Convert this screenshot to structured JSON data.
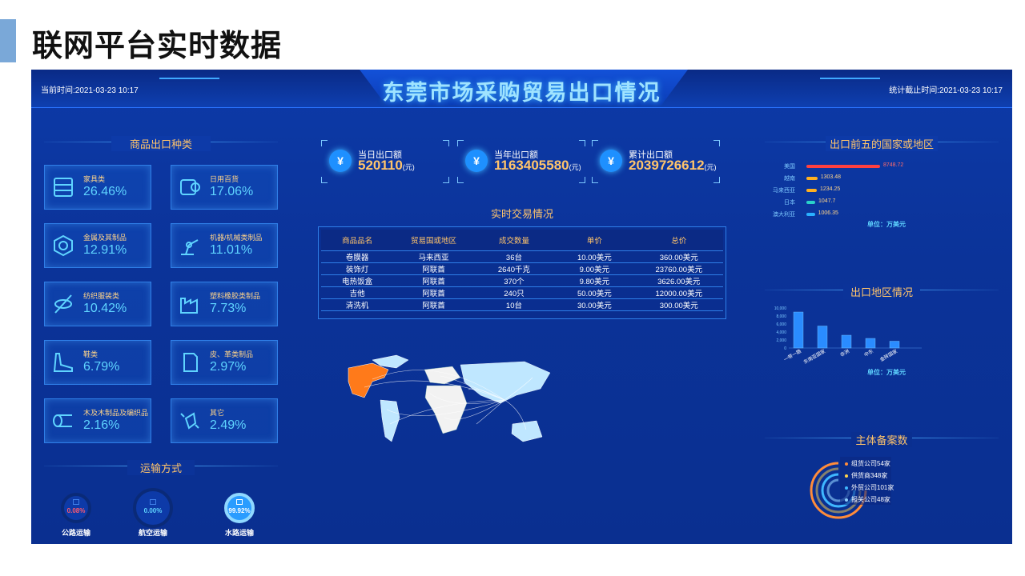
{
  "slide": {
    "title": "联网平台实时数据"
  },
  "header": {
    "main_title": "东莞市场采购贸易出口情况",
    "current_time": "当前时间:2021-03-23 10:17",
    "deadline_time": "统计截止时间:2021-03-23 10:17"
  },
  "categories": {
    "title": "商品出口种类",
    "items": [
      {
        "name": "家具类",
        "pct": "26.46%",
        "icon": "furniture-icon"
      },
      {
        "name": "日用百货",
        "pct": "17.06%",
        "icon": "tissue-roll-icon"
      },
      {
        "name": "金属及其制品",
        "pct": "12.91%",
        "icon": "hex-nut-icon"
      },
      {
        "name": "机器/机械类制品",
        "pct": "11.01%",
        "icon": "robot-arm-icon"
      },
      {
        "name": "纺织服装类",
        "pct": "10.42%",
        "icon": "thread-icon"
      },
      {
        "name": "塑料橡胶类制品",
        "pct": "7.73%",
        "icon": "factory-icon"
      },
      {
        "name": "鞋类",
        "pct": "6.79%",
        "icon": "shoe-icon"
      },
      {
        "name": "皮、革类制品",
        "pct": "2.97%",
        "icon": "leather-icon"
      },
      {
        "name": "木及木制品及编织品",
        "pct": "2.16%",
        "icon": "wood-log-icon"
      },
      {
        "name": "其它",
        "pct": "2.49%",
        "icon": "other-icon"
      }
    ]
  },
  "transport": {
    "title": "运输方式",
    "items": [
      {
        "label": "公路运输",
        "pct": "0.08%",
        "icon": "truck-icon",
        "color": "#ff5a6e"
      },
      {
        "label": "航空运输",
        "pct": "0.00%",
        "icon": "plane-icon",
        "color": "#5fd4ff"
      },
      {
        "label": "水路运输",
        "pct": "99.92%",
        "icon": "ship-icon",
        "color": "#ffffff"
      }
    ]
  },
  "kpis": [
    {
      "label": "当日出口额",
      "value": "520110",
      "unit": "(元)",
      "icon": "yen-icon"
    },
    {
      "label": "当年出口额",
      "value": "1163405580",
      "unit": "(元)",
      "icon": "yen-icon"
    },
    {
      "label": "累计出口额",
      "value": "2039726612",
      "unit": "(元)",
      "icon": "yen-icon"
    }
  ],
  "trades": {
    "title": "实时交易情况",
    "columns": [
      "商品品名",
      "贸易国或地区",
      "成交数量",
      "单价",
      "总价"
    ],
    "rows": [
      [
        "卷膜器",
        "马来西亚",
        "36台",
        "10.00美元",
        "360.00美元"
      ],
      [
        "装饰灯",
        "阿联酋",
        "2640千克",
        "9.00美元",
        "23760.00美元"
      ],
      [
        "电热饭盒",
        "阿联酋",
        "370个",
        "9.80美元",
        "3626.00美元"
      ],
      [
        "吉他",
        "阿联酋",
        "240只",
        "50.00美元",
        "12000.00美元"
      ],
      [
        "清洗机",
        "阿联酋",
        "10台",
        "30.00美元",
        "300.00美元"
      ]
    ]
  },
  "top5": {
    "title": "出口前五的国家或地区",
    "unit": "单位：万美元",
    "chart_data": {
      "type": "bar",
      "categories": [
        "美国",
        "越南",
        "马来西亚",
        "日本",
        "澳大利亚"
      ],
      "values": [
        8748.72,
        1303.48,
        1234.25,
        1047.7,
        1006.35
      ],
      "value_labels": [
        "8748.72",
        "1303.48",
        "1234.25",
        "1047.7",
        "1006.35"
      ],
      "colors": [
        "#ff4040",
        "#ffb020",
        "#ffb020",
        "#2ad1c9",
        "#2ab0ff"
      ]
    }
  },
  "regions": {
    "title": "出口地区情况",
    "unit": "单位：万美元",
    "chart_data": {
      "type": "bar",
      "categories": [
        "一带一路",
        "东南亚国家",
        "非洲",
        "中东",
        "金砖国家"
      ],
      "values": [
        9000,
        5500,
        3200,
        2400,
        1700
      ],
      "ylim": [
        0,
        10000
      ],
      "yticks": [
        "10,000",
        "8,000",
        "6,000",
        "4,000",
        "2,000",
        "0"
      ]
    }
  },
  "registry": {
    "title": "主体备案数",
    "items": [
      {
        "label": "组货公司54家",
        "color": "#ff8c3a"
      },
      {
        "label": "供货商348家",
        "color": "#ffd24a"
      },
      {
        "label": "外贸公司101家",
        "color": "#3fb7ff"
      },
      {
        "label": "报关公司48家",
        "color": "#8fd0ff"
      }
    ]
  },
  "map": {
    "highlight_colors": [
      "#ff7a1a",
      "#bfe7ff",
      "#f2f2f2"
    ]
  }
}
